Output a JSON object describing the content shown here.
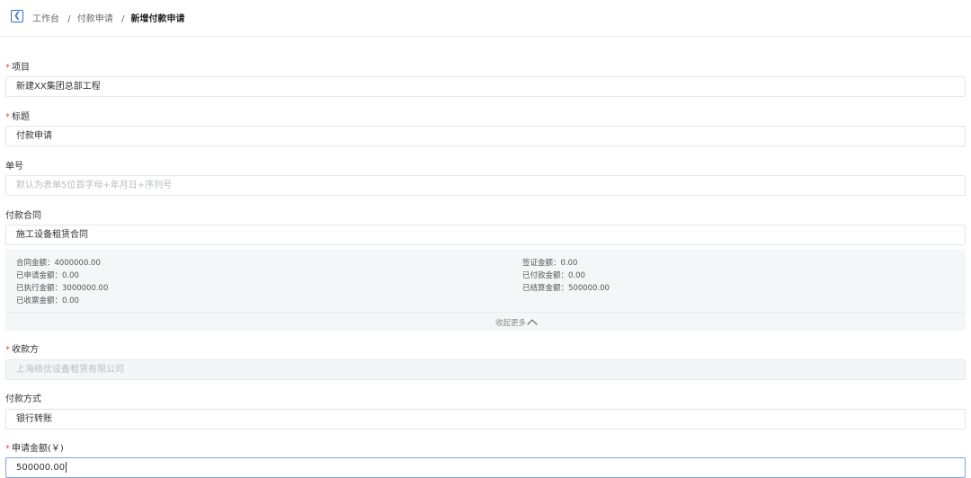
{
  "breadcrumb": {
    "back_icon": "chevron-left-icon",
    "items": [
      "工作台",
      "付款申请"
    ],
    "current": "新增付款申请"
  },
  "form": {
    "project": {
      "label": "项目",
      "required": true,
      "value": "新建XX集团总部工程"
    },
    "title": {
      "label": "标题",
      "required": true,
      "value": "付款申请"
    },
    "number": {
      "label": "单号",
      "required": false,
      "placeholder": "默认为表单5位首字母+年月日+序列号"
    },
    "contract": {
      "label": "付款合同",
      "required": false,
      "value": "施工设备租赁合同",
      "details": {
        "contract_amount": "合同金额：4000000.00",
        "visa_amount": "签证金额：0.00",
        "applied_amount": "已申请金额：0.00",
        "paid_amount": "已付款金额：0.00",
        "executed_amount": "已执行金额：3000000.00",
        "settled_amount": "已结算金额：500000.00",
        "invoiced_amount": "已收票金额：0.00"
      },
      "collapse_label": "收起更多",
      "collapse_icon": "chevron-up-icon"
    },
    "payee": {
      "label": "收款方",
      "required": true,
      "value": "上海络优设备租赁有限公司",
      "disabled": true
    },
    "payment_method": {
      "label": "付款方式",
      "required": false,
      "value": "银行转账"
    },
    "amount": {
      "label": "申请金额(￥)",
      "required": true,
      "value": "500000.00"
    }
  },
  "colors": {
    "accent": "#2f6fd8",
    "required": "#e0513c",
    "panel_bg": "#f5f6f8"
  }
}
